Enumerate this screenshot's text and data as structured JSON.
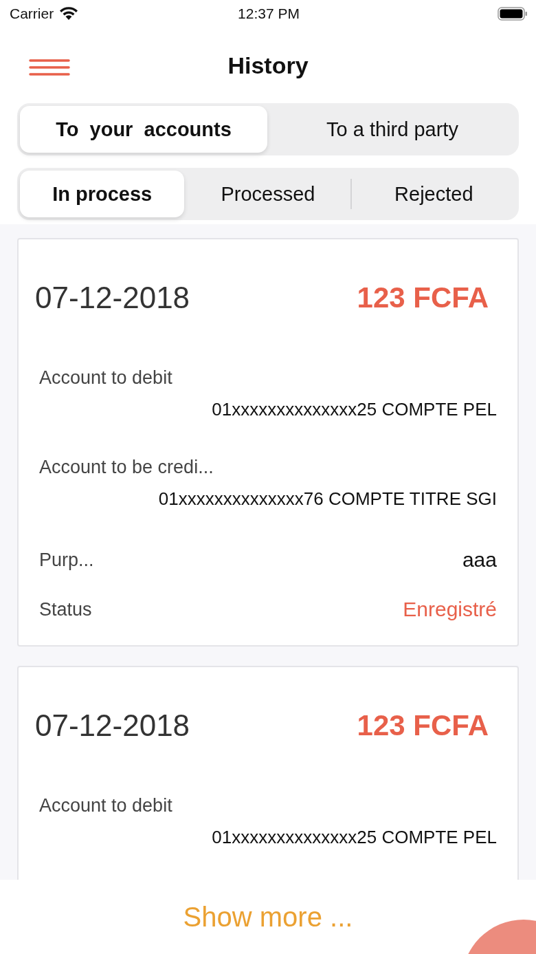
{
  "status_bar": {
    "carrier": "Carrier",
    "time": "12:37 PM"
  },
  "header": {
    "title": "History"
  },
  "destination_tabs": [
    {
      "label": "To  your  accounts",
      "selected": true
    },
    {
      "label": "To a third party",
      "selected": false
    }
  ],
  "status_tabs": [
    {
      "label": "In process",
      "selected": true
    },
    {
      "label": "Processed",
      "selected": false
    },
    {
      "label": "Rejected",
      "selected": false
    }
  ],
  "transfers": [
    {
      "date": "07-12-2018",
      "amount": "123 FCFA",
      "rows": [
        {
          "kind": "stacked",
          "label": "Account to debit",
          "value": "01xxxxxxxxxxxxxx25 COMPTE PEL"
        },
        {
          "kind": "stacked",
          "label": "Account to be credi...",
          "value": "01xxxxxxxxxxxxxx76 COMPTE TITRE SGI"
        },
        {
          "kind": "inline",
          "label": "Purp...",
          "value": "aaa"
        },
        {
          "kind": "status",
          "label": "Status",
          "value": "Enregistré"
        }
      ]
    },
    {
      "date": "07-12-2018",
      "amount": "123 FCFA",
      "rows": [
        {
          "kind": "stacked",
          "label": "Account to debit",
          "value": "01xxxxxxxxxxxxxx25 COMPTE PEL"
        }
      ]
    }
  ],
  "footer": {
    "link": "Show more ..."
  }
}
